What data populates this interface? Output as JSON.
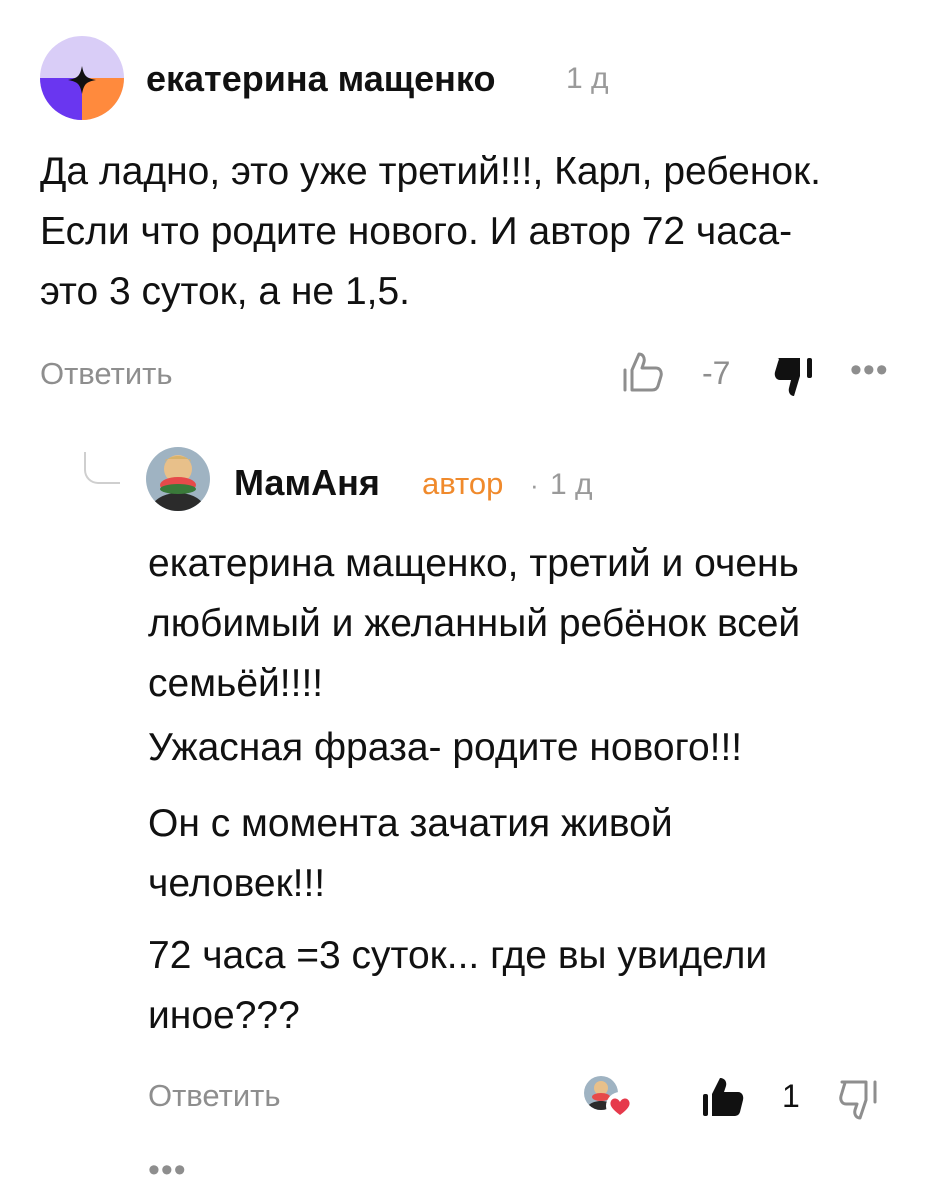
{
  "comment": {
    "author": "екатерина мащенко",
    "time": "1 д",
    "text_lines": [
      "Да ладно, это уже третий!!!, Карл, ребенок.",
      "Если что родите нового. И автор 72 часа-",
      "это 3 суток, а не 1,5."
    ],
    "reply_label": "Ответить",
    "likes": "-7",
    "avatar_colors": {
      "top": "#d9cdf7",
      "bottom_left": "#6a36f0",
      "bottom_right": "#ff8a3d"
    }
  },
  "reply": {
    "author": "МамАня",
    "badge": "автор",
    "time": "1 д",
    "text_lines": [
      "екатерина мащенко, третий и очень",
      "любимый и желанный ребёнок всей",
      "семьёй!!!!",
      "Ужасная фраза- родите нового!!!",
      "Он с момента зачатия живой",
      "человек!!!",
      "72 часа =3 суток... где вы увидели",
      "иное???"
    ],
    "reply_label": "Ответить",
    "likes": "1",
    "accent_color": "#f08a2c",
    "heart_color": "#e63a4c"
  }
}
